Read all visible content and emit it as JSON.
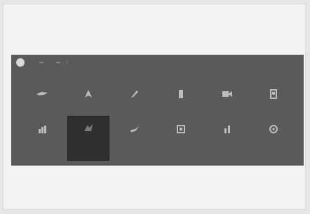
{
  "colors": {
    "background": "#e6e6e6",
    "panel": "#5a5a5a",
    "tile_active": "#2f2f2f",
    "icon": "#bdbdbd",
    "label": "#9a9a9a"
  },
  "topbar": {
    "logo_icon": "app-logo-icon",
    "icons": [
      "dot-icon",
      "dot-icon",
      "chevron-right-icon"
    ]
  },
  "tiles": [
    {
      "label": "",
      "icon": "tile-icon-1"
    },
    {
      "label": "",
      "icon": "tile-icon-2"
    },
    {
      "label": "",
      "icon": "tile-icon-3"
    },
    {
      "label": "",
      "icon": "tile-icon-4"
    },
    {
      "label": "",
      "icon": "tile-icon-5"
    },
    {
      "label": "",
      "icon": "tile-icon-6"
    },
    {
      "label": "",
      "icon": "tile-icon-7"
    },
    {
      "label": "",
      "icon": "tile-icon-8"
    },
    {
      "label": "",
      "icon": "tile-icon-9"
    },
    {
      "label": "",
      "icon": "tile-icon-10"
    },
    {
      "label": "",
      "icon": "tile-icon-11"
    },
    {
      "label": "",
      "icon": "tile-icon-12"
    }
  ],
  "selected_tile": "tile-8"
}
